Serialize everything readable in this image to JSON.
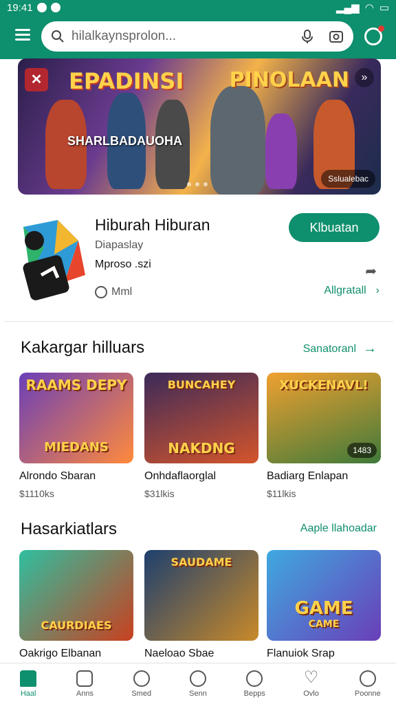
{
  "status_bar": {
    "time": "19:41"
  },
  "search": {
    "placeholder": "hilalkaynsprolon..."
  },
  "banner": {
    "title_left": "EPADINSI",
    "title_right": "PINOLAAN",
    "caption": "SHARLBADAUOHA",
    "tag": "Sslualebac"
  },
  "app": {
    "title": "Hiburah Hiburan",
    "subtitle": "Diapaslay",
    "publisher": "Mproso .szi",
    "meta": "Mml",
    "install_label": "Klbuatan",
    "all_label": "Allgratall"
  },
  "section1": {
    "title": "Kakargar hilluars",
    "link": "Sanatoranl",
    "games": [
      {
        "thumb_title": "RAAMS DEPY",
        "thumb_sub": "MIEDANS",
        "name": "Alrondo Sbaran",
        "price": "$1110ks",
        "color1": "#ff8a3c",
        "color2": "#6a3fb8"
      },
      {
        "thumb_title": "BUNCAHEY",
        "thumb_sub": "NAKDNG",
        "name": "Onhdaflaorglal",
        "price": "$31lkis",
        "color1": "#3b2a5a",
        "color2": "#d4552b"
      },
      {
        "thumb_title": "XUCKENAVL!",
        "thumb_sub": "",
        "pill": "1483",
        "name": "Badiarg Enlapan",
        "price": "$11lkis",
        "color1": "#f0a030",
        "color2": "#3f7a3a"
      }
    ]
  },
  "section2": {
    "title": "Hasarkiatlars",
    "link": "Aaple llahoadar",
    "games": [
      {
        "thumb_title": "CAURDIAES",
        "name": "Oakrigo Elbanan",
        "color1": "#2fbfa0",
        "color2": "#c9401f"
      },
      {
        "thumb_title": "SAUDAME",
        "name": "Naeloao Sbae",
        "color1": "#1d3f6e",
        "color2": "#c98a2a"
      },
      {
        "thumb_title": "GAME",
        "thumb_sub": "CAME",
        "name": "Flanuiok Srap",
        "color1": "#3fa9e0",
        "color2": "#6a3fb8"
      }
    ]
  },
  "nav": [
    {
      "label": "Haal",
      "icon": "home-icon"
    },
    {
      "label": "Anns",
      "icon": "apps-icon"
    },
    {
      "label": "Smed",
      "icon": "profile-icon"
    },
    {
      "label": "Senn",
      "icon": "compass-icon"
    },
    {
      "label": "Bepps",
      "icon": "group-icon"
    },
    {
      "label": "Ovlo",
      "icon": "heart-icon"
    },
    {
      "label": "Poonne",
      "icon": "info-icon"
    }
  ],
  "colors": {
    "accent": "#0e8f6d"
  }
}
